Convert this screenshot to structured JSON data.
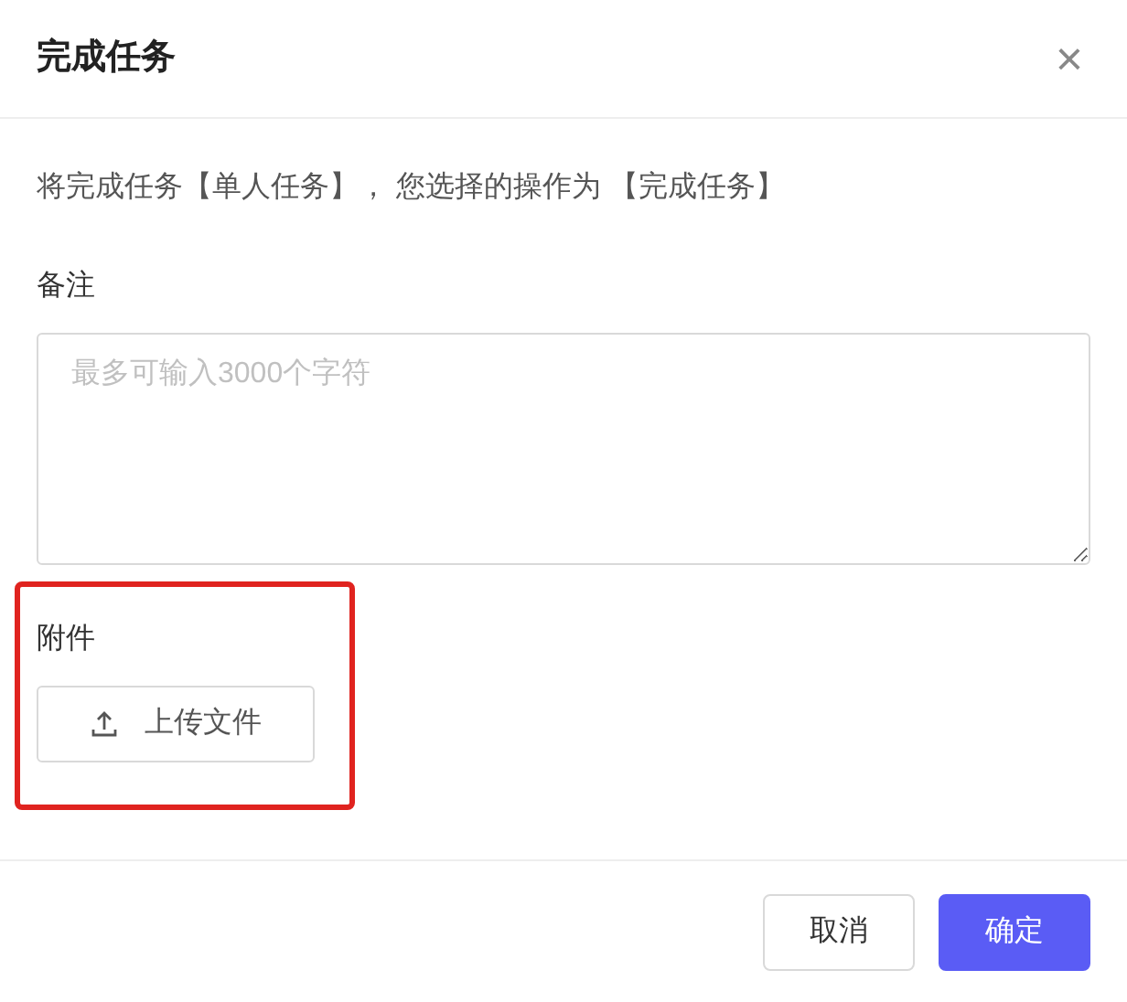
{
  "dialog": {
    "title": "完成任务",
    "close": "×"
  },
  "message": "将完成任务【单人任务】， 您选择的操作为 【完成任务】",
  "remark": {
    "label": "备注",
    "placeholder": "最多可输入3000个字符"
  },
  "attachment": {
    "label": "附件",
    "upload_button": "上传文件",
    "highlighted": true
  },
  "buttons": [
    {
      "label": "取消",
      "kind": "secondary"
    },
    {
      "label": "确定",
      "kind": "primary"
    }
  ]
}
